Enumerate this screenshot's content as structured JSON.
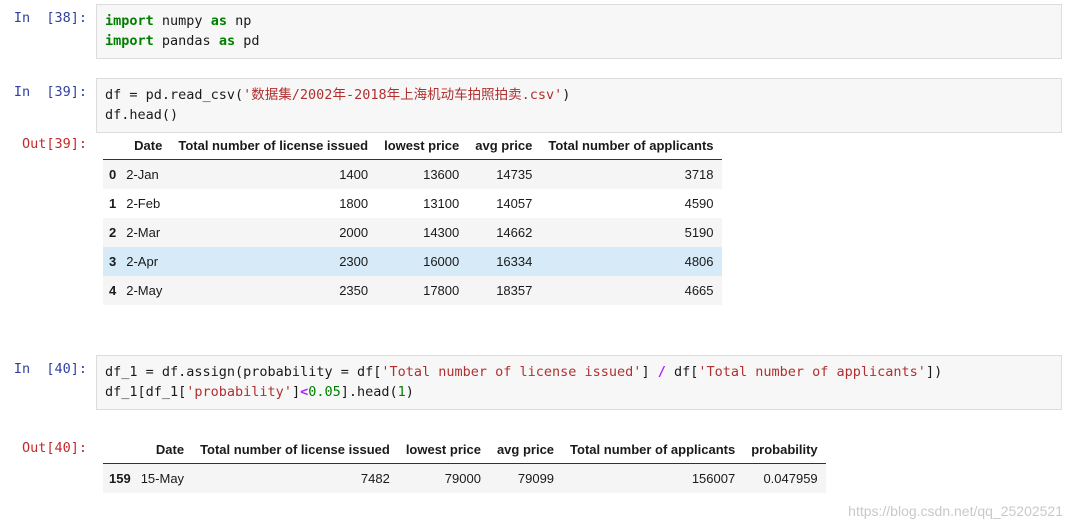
{
  "cells": [
    {
      "prompt": "In  [38]:",
      "type": "code",
      "lines": [
        [
          {
            "t": "import",
            "c": "kw"
          },
          {
            "t": " numpy ",
            "c": "plain"
          },
          {
            "t": "as",
            "c": "kw"
          },
          {
            "t": " np",
            "c": "plain"
          }
        ],
        [
          {
            "t": "import",
            "c": "kw"
          },
          {
            "t": " pandas ",
            "c": "plain"
          },
          {
            "t": "as",
            "c": "kw"
          },
          {
            "t": " pd",
            "c": "plain"
          }
        ]
      ]
    },
    {
      "prompt": "In  [39]:",
      "type": "code",
      "lines": [
        [
          {
            "t": "df = pd.read_csv(",
            "c": "plain"
          },
          {
            "t": "'数据集/2002年-2018年上海机动车拍照拍卖.csv'",
            "c": "str"
          },
          {
            "t": ")",
            "c": "plain"
          }
        ],
        [
          {
            "t": "df.head()",
            "c": "plain"
          }
        ]
      ]
    },
    {
      "prompt": "Out[39]:",
      "type": "output_table",
      "table_ref": "table_39"
    },
    {
      "prompt": "In  [40]:",
      "type": "code",
      "lines": [
        [
          {
            "t": "df_1 = df.assign(probability = df[",
            "c": "plain"
          },
          {
            "t": "'Total number of license issued'",
            "c": "str"
          },
          {
            "t": "] ",
            "c": "plain"
          },
          {
            "t": "/",
            "c": "op"
          },
          {
            "t": " df[",
            "c": "plain"
          },
          {
            "t": "'Total number of applicants'",
            "c": "str"
          },
          {
            "t": "])",
            "c": "plain"
          }
        ],
        [
          {
            "t": "df_1[df_1[",
            "c": "plain"
          },
          {
            "t": "'probability'",
            "c": "str"
          },
          {
            "t": "]",
            "c": "plain"
          },
          {
            "t": "<",
            "c": "op"
          },
          {
            "t": "0.05",
            "c": "num"
          },
          {
            "t": "].head(",
            "c": "plain"
          },
          {
            "t": "1",
            "c": "num"
          },
          {
            "t": ")",
            "c": "plain"
          }
        ]
      ]
    },
    {
      "prompt": "Out[40]:",
      "type": "output_table",
      "table_ref": "table_40"
    }
  ],
  "table_39": {
    "columns": [
      "Date",
      "Total number of license issued",
      "lowest price",
      "avg price",
      "Total number of applicants"
    ],
    "index": [
      "0",
      "1",
      "2",
      "3",
      "4"
    ],
    "rows": [
      [
        "2-Jan",
        "1400",
        "13600",
        "14735",
        "3718"
      ],
      [
        "2-Feb",
        "1800",
        "13100",
        "14057",
        "4590"
      ],
      [
        "2-Mar",
        "2000",
        "14300",
        "14662",
        "5190"
      ],
      [
        "2-Apr",
        "2300",
        "16000",
        "16334",
        "4806"
      ],
      [
        "2-May",
        "2350",
        "17800",
        "18357",
        "4665"
      ]
    ],
    "row_styles": [
      "stripe",
      "plain",
      "stripe",
      "hl",
      "stripe"
    ]
  },
  "table_40": {
    "columns": [
      "Date",
      "Total number of license issued",
      "lowest price",
      "avg price",
      "Total number of applicants",
      "probability"
    ],
    "index": [
      "159"
    ],
    "rows": [
      [
        "15-May",
        "7482",
        "79000",
        "79099",
        "156007",
        "0.047959"
      ]
    ],
    "row_styles": [
      "stripe"
    ]
  },
  "watermark": "https://blog.csdn.net/qq_25202521",
  "colors": {
    "in_prompt": "#303f9f",
    "out_prompt": "#c62828",
    "keyword": "#008000",
    "string": "#b03030",
    "number": "#008000",
    "operator": "#aa22ff",
    "cell_bg": "#f7f7f7",
    "cell_border": "#dcdcdc",
    "row_stripe": "#f5f5f5",
    "row_highlight": "#d6eaf8"
  }
}
